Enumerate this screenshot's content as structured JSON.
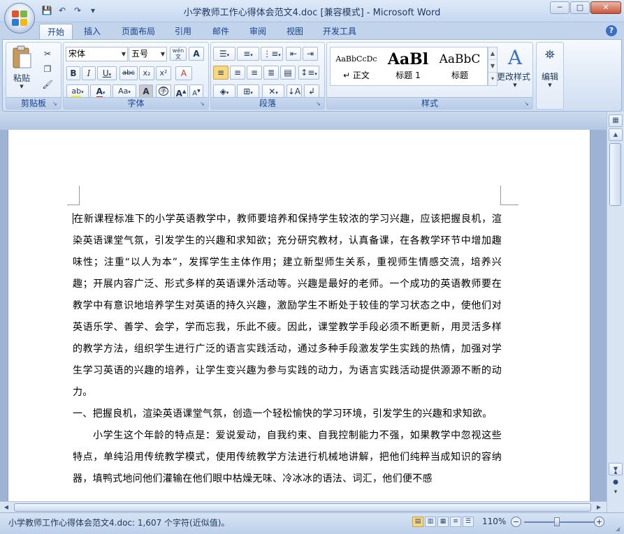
{
  "window": {
    "title": "小学教师工作心得体会范文4.doc [兼容模式] - Microsoft Word",
    "controls": {
      "minimize": "─",
      "maximize": "□",
      "close": "✕"
    }
  },
  "qat": {
    "save_icon": "💾",
    "undo_icon": "↶",
    "redo_icon": "↷",
    "customize_icon": "▾"
  },
  "tabs": [
    "开始",
    "插入",
    "页面布局",
    "引用",
    "邮件",
    "审阅",
    "视图",
    "开发工具"
  ],
  "active_tab": "开始",
  "help": "?",
  "ribbon": {
    "clipboard": {
      "label": "剪贴板",
      "paste": "粘贴"
    },
    "font": {
      "label": "字体",
      "font_name": "宋体",
      "font_size": "五号",
      "wen": "wén",
      "a_box": "A",
      "bold": "B",
      "italic": "I",
      "underline": "U",
      "strike": "abc",
      "sub": "x₂",
      "sup": "x²",
      "clear": "A",
      "highlight": "ab",
      "color": "A",
      "aa": "Aa",
      "char_shade": "A",
      "enclose": "字",
      "grow": "A",
      "shrink": "A"
    },
    "paragraph": {
      "label": "段落"
    },
    "styles": {
      "label": "样式",
      "items": [
        {
          "preview": "AaBbCcDc",
          "name": "↵ 正文"
        },
        {
          "preview": "AaBl",
          "name": "标题 1"
        },
        {
          "preview": "AaBbC",
          "name": "标题"
        }
      ],
      "change_styles": "更改样式"
    },
    "editing": {
      "label": "编辑"
    }
  },
  "document": {
    "paragraphs": [
      {
        "text": "在新课程标准下的小学英语教学中，教师要培养和保持学生较浓的学习兴趣，应该把握良机，渲染英语课堂气氛，引发学生的兴趣和求知欲；充分研究教材，认真备课，在各教学环节中增加趣味性；注重“以人为本”，发挥学生主体作用；建立新型师生关系，重视师生情感交流，培养兴趣；开展内容广泛、形式多样的英语课外活动等。兴趣是最好的老师。一个成功的英语教师要在教学中有意识地培养学生对英语的持久兴趣，激励学生不断处于较佳的学习状态之中，使他们对英语乐学、善学、会学，学而忘我，乐此不疲。因此，课堂教学手段必须不断更新，用灵活多样的教学方法，组织学生进行广泛的语言实践活动，通过多种手段激发学生实践的热情，加强对学生学习英语的兴趣的培养，让学生变兴趣为参与实践的动力，为语言实践活动提供源源不断的动力。"
      },
      {
        "text": "一、把握良机，渲染英语课堂气氛，创造一个轻松愉快的学习环境，引发学生的兴趣和求知欲。"
      },
      {
        "text": "小学生这个年龄的特点是：爱说爱动，自我约束、自我控制能力不强，如果教学中忽视这些特点，单纯沿用传统教学模式，使用传统教学方法进行机械地讲解，把他们纯粹当成知识的容纳器，填鸭式地问他们灌输在他们眼中枯燥无味、冷冰冰的语法、词汇，他们便不感"
      }
    ]
  },
  "status": {
    "doc_info": "小学教师工作心得体会范文4.doc: 1,607 个字符(近似值)。",
    "zoom": "110%",
    "zoom_minus": "−",
    "zoom_plus": "+"
  }
}
